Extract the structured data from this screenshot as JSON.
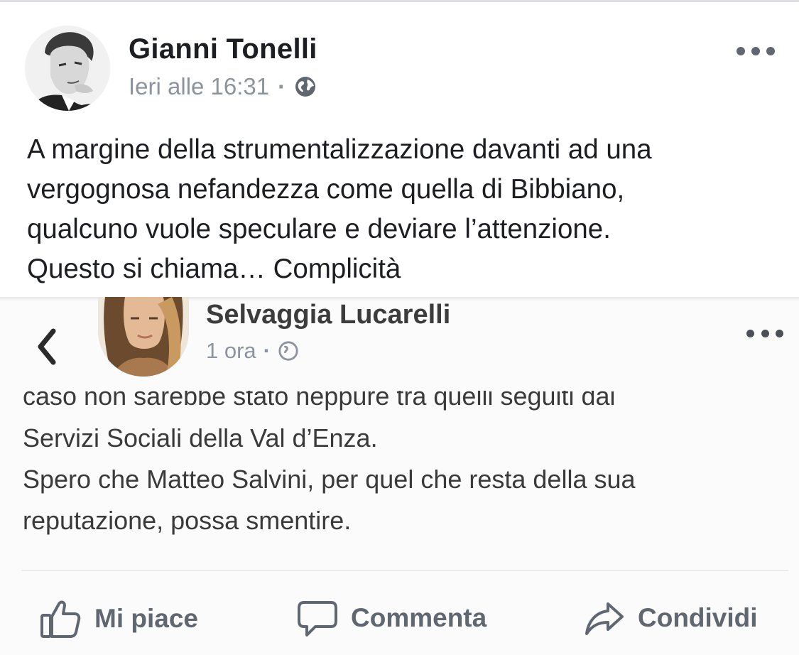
{
  "post": {
    "author": "Gianni Tonelli",
    "timestamp": "Ieri alle 16:31",
    "separator": "·",
    "privacy_icon": "globe-icon",
    "more_icon": "more-dots-icon",
    "text_lines": [
      "A margine della strumentalizzazione davanti ad una",
      "vergognosa nefandezza come quella di Bibbiano,",
      "qualcuno vuole speculare e deviare l’attenzione.",
      "Questo si chiama… Complicità"
    ]
  },
  "shared": {
    "back_icon": "chevron-left-icon",
    "author": "Selvaggia Lucarelli",
    "timestamp": "1 ora",
    "separator": "·",
    "text_lines": [
      "caso non sarebbe stato neppure tra quelli seguiti dai",
      "Servizi Sociali della Val d’Enza.",
      "Spero che Matteo Salvini, per quel che resta della sua",
      "reputazione, possa smentire."
    ],
    "actions": {
      "like": "Mi piace",
      "comment": "Commenta",
      "share": "Condividi"
    }
  },
  "colors": {
    "text": "#1c1e21",
    "meta": "#8d949e",
    "action": "#606770"
  }
}
